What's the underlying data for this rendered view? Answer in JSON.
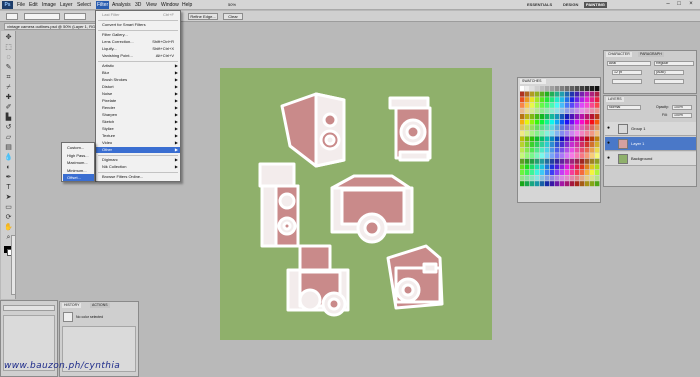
{
  "app": {
    "logo": "Ps",
    "menus": [
      "File",
      "Edit",
      "Image",
      "Layer",
      "Select",
      "Filter",
      "Analysis",
      "3D",
      "View",
      "Window",
      "Help"
    ],
    "active_menu": "Filter",
    "zoom": "50%",
    "workspaces": [
      "ESSENTIALS",
      "DESIGN",
      "PAINTING"
    ],
    "active_workspace": "PAINTING"
  },
  "options_bar": {
    "refine_edge": "Refine Edge...",
    "clear_label": "Clear"
  },
  "document": {
    "tab_title": "vintage camera outlines.psd @ 50% (Layer 1, RGB/8)"
  },
  "filter_menu": {
    "items": [
      {
        "label": "Last Filter",
        "shortcut": "Ctrl+F",
        "disabled": true
      },
      {
        "label": "Convert for Smart Filters"
      },
      {
        "label": "Filter Gallery..."
      },
      {
        "label": "Lens Correction...",
        "shortcut": "Shift+Ctrl+R"
      },
      {
        "label": "Liquify...",
        "shortcut": "Shift+Ctrl+X"
      },
      {
        "label": "Vanishing Point...",
        "shortcut": "Alt+Ctrl+V"
      },
      {
        "label": "Artistic",
        "submenu": true
      },
      {
        "label": "Blur",
        "submenu": true
      },
      {
        "label": "Brush Strokes",
        "submenu": true
      },
      {
        "label": "Distort",
        "submenu": true
      },
      {
        "label": "Noise",
        "submenu": true
      },
      {
        "label": "Pixelate",
        "submenu": true
      },
      {
        "label": "Render",
        "submenu": true
      },
      {
        "label": "Sharpen",
        "submenu": true
      },
      {
        "label": "Sketch",
        "submenu": true
      },
      {
        "label": "Stylize",
        "submenu": true
      },
      {
        "label": "Texture",
        "submenu": true
      },
      {
        "label": "Video",
        "submenu": true
      },
      {
        "label": "Other",
        "submenu": true,
        "highlighted": true
      },
      {
        "label": "Digimarc",
        "submenu": true
      },
      {
        "label": "Nik Collection",
        "submenu": true
      },
      {
        "label": "Browse Filters Online..."
      }
    ]
  },
  "other_submenu": {
    "items": [
      {
        "label": "Custom..."
      },
      {
        "label": "High Pass..."
      },
      {
        "label": "Maximum..."
      },
      {
        "label": "Minimum..."
      },
      {
        "label": "Offset...",
        "highlighted": true
      }
    ]
  },
  "swatches": {
    "tab_label": "SWATCHES"
  },
  "character_panel": {
    "tab_label": "CHARACTER",
    "tab2_label": "PARAGRAPH",
    "font_family": "Arial",
    "font_style": "Regular",
    "font_size": "12 pt",
    "leading": "(Auto)"
  },
  "layers_panel": {
    "tab_label": "LAYERS",
    "blend_mode": "Normal",
    "opacity_label": "Opacity:",
    "opacity": "100%",
    "fill_label": "Fill:",
    "fill": "100%",
    "layers": [
      {
        "name": "Group 1",
        "selected": false,
        "thumb": "#d9d9d9"
      },
      {
        "name": "Layer 1",
        "selected": true,
        "thumb": "#d4a0a0"
      },
      {
        "name": "Background",
        "selected": false,
        "thumb": "#8fb06b"
      }
    ]
  },
  "history_panel": {
    "tab_label": "HISTORY",
    "tab2_label": "ACTIONS",
    "item_label": "No color selected"
  },
  "watermark": "www.bauzon.ph/cynthia",
  "colors": {
    "canvas_bg": "#8fb06b",
    "camera_fill": "#c98a8a",
    "camera_outline": "#ffffff",
    "menu_highlight": "#3a6ed1"
  }
}
